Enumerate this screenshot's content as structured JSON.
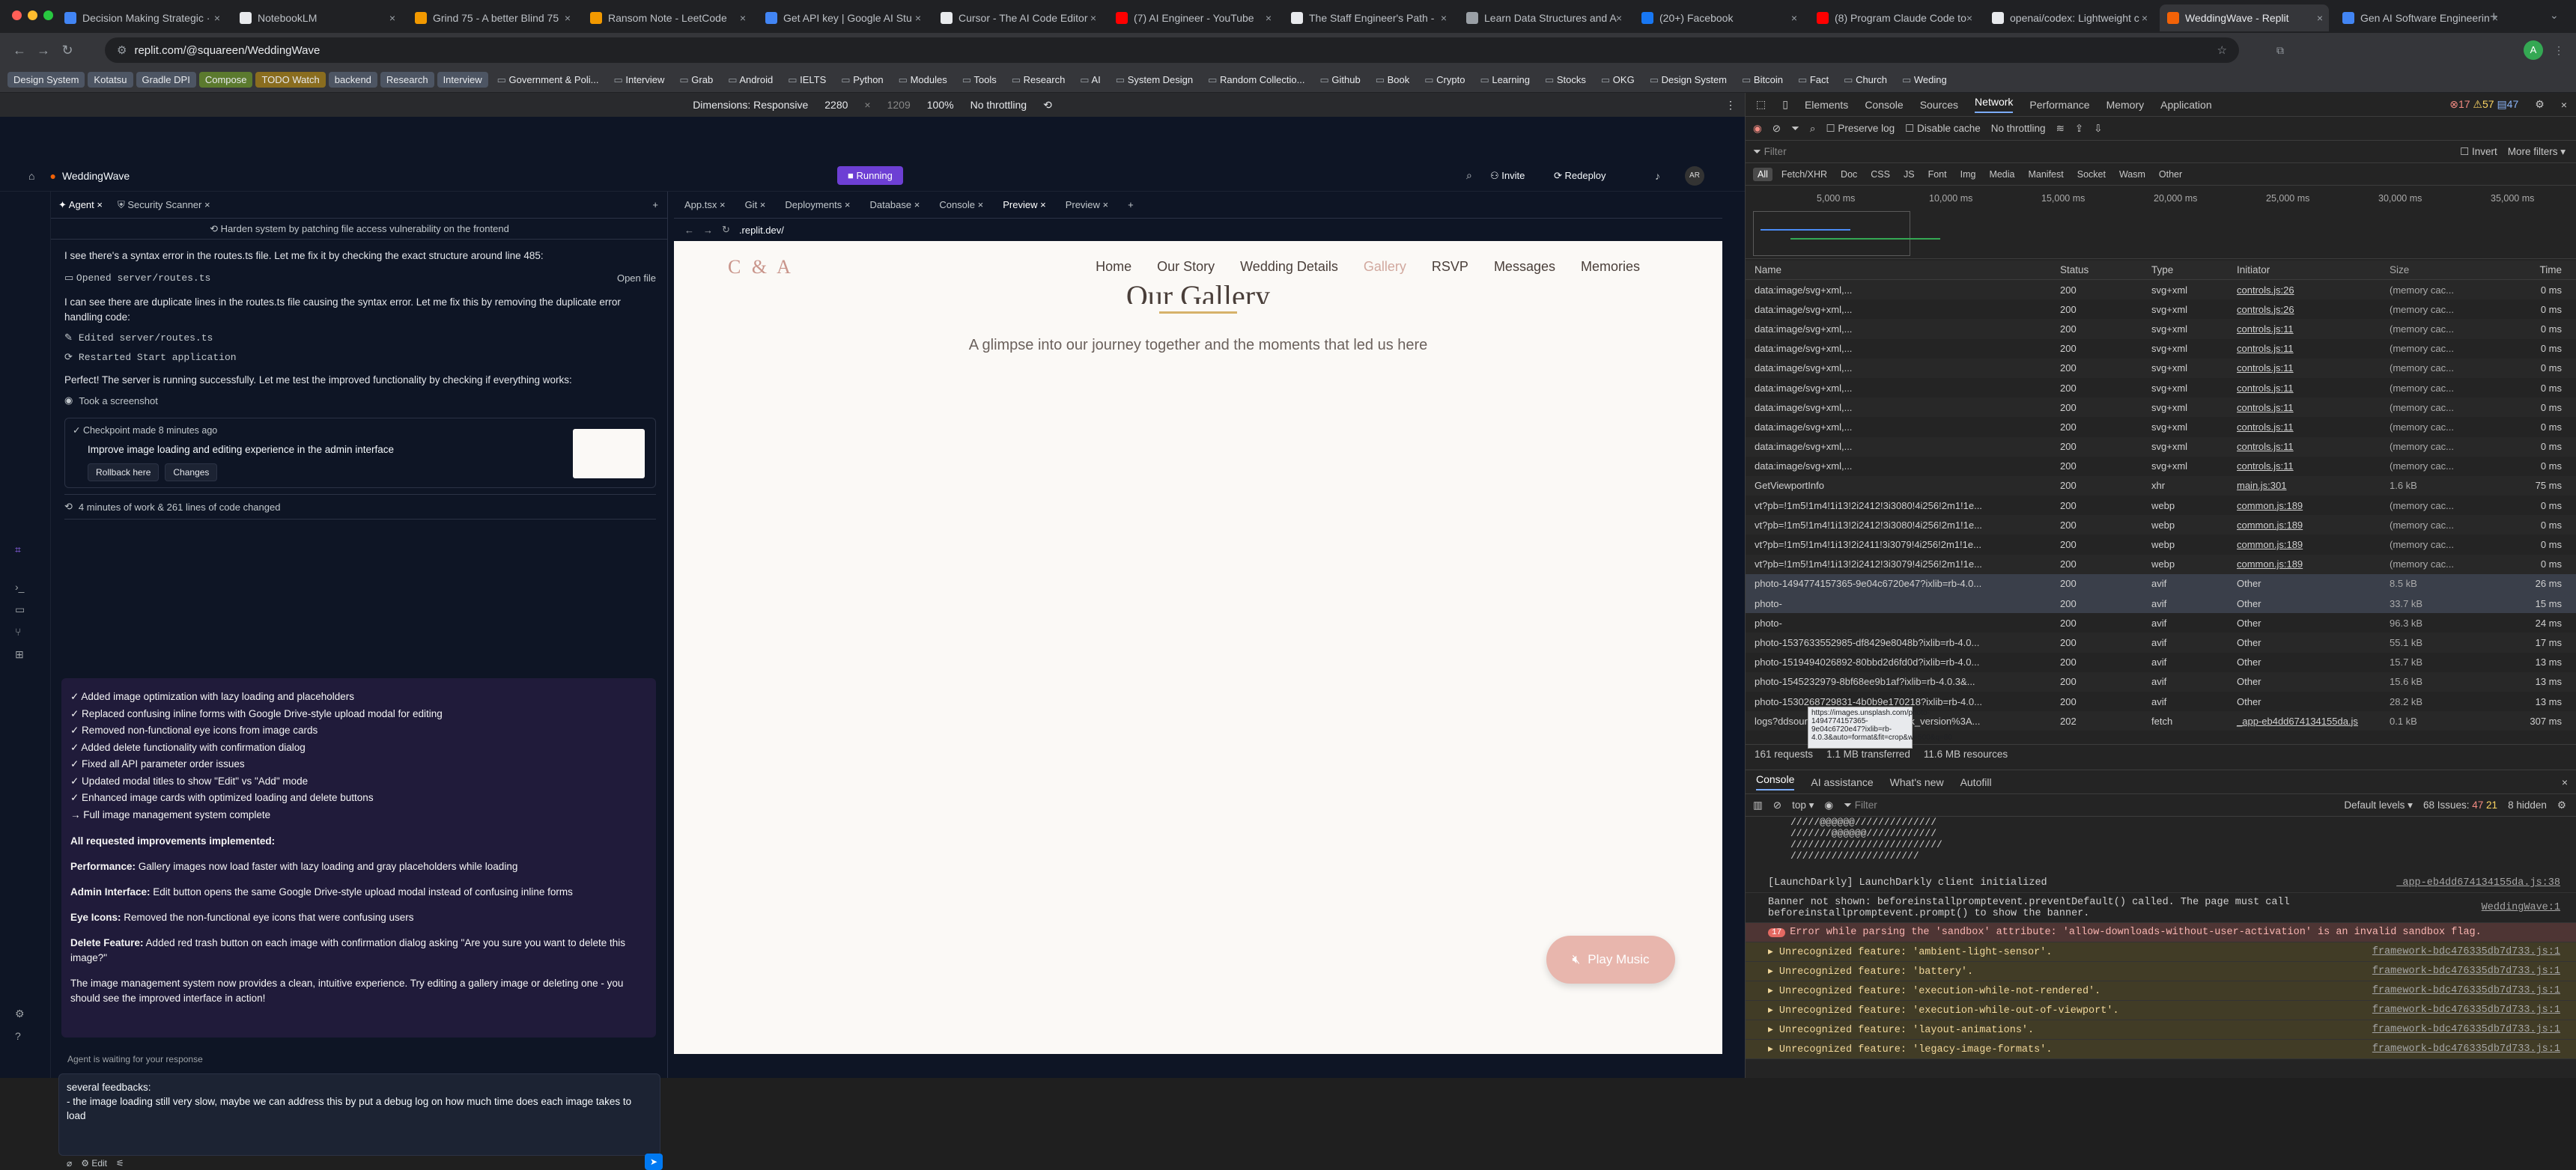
{
  "browser": {
    "tabs": [
      {
        "title": "Decision Making Strategic ·",
        "color": "#4285f4"
      },
      {
        "title": "NotebookLM",
        "color": "#e8eaed"
      },
      {
        "title": "Grind 75 - A better Blind 75",
        "color": "#f29900"
      },
      {
        "title": "Ransom Note - LeetCode",
        "color": "#f29900"
      },
      {
        "title": "Get API key | Google AI Stu",
        "color": "#4285f4"
      },
      {
        "title": "Cursor - The AI Code Editor",
        "color": "#e8eaed"
      },
      {
        "title": "(7) AI Engineer - YouTube",
        "color": "#ff0000"
      },
      {
        "title": "The Staff Engineer's Path -",
        "color": "#e8eaed"
      },
      {
        "title": "Learn Data Structures and A",
        "color": "#9aa0a6"
      },
      {
        "title": "(20+) Facebook",
        "color": "#1877f2"
      },
      {
        "title": "(8) Program Claude Code to",
        "color": "#ff0000"
      },
      {
        "title": "openai/codex: Lightweight c",
        "color": "#e8eaed"
      },
      {
        "title": "WeddingWave - Replit",
        "color": "#f26207"
      },
      {
        "title": "Gen AI Software Engineerin",
        "color": "#4285f4"
      }
    ],
    "url": "replit.com/@squareen/WeddingWave",
    "bookmarks": [
      {
        "label": "Design System",
        "tag": true
      },
      {
        "label": "Kotatsu",
        "tag": true
      },
      {
        "label": "Gradle DPI",
        "tag": true
      },
      {
        "label": "Compose",
        "tag": true
      },
      {
        "label": "TODO Watch",
        "tag": true
      },
      {
        "label": "backend",
        "tag": true
      },
      {
        "label": "Research",
        "tag": true
      },
      {
        "label": "Interview",
        "tag": true
      },
      {
        "label": "Government & Poli...",
        "tag": false
      },
      {
        "label": "Interview",
        "tag": false
      },
      {
        "label": "Grab",
        "tag": false
      },
      {
        "label": "Android",
        "tag": false
      },
      {
        "label": "IELTS",
        "tag": false
      },
      {
        "label": "Python",
        "tag": false
      },
      {
        "label": "Modules",
        "tag": false
      },
      {
        "label": "Tools",
        "tag": false
      },
      {
        "label": "Research",
        "tag": false
      },
      {
        "label": "AI",
        "tag": false
      },
      {
        "label": "System Design",
        "tag": false
      },
      {
        "label": "Random Collectio...",
        "tag": false
      },
      {
        "label": "Github",
        "tag": false
      },
      {
        "label": "Book",
        "tag": false
      },
      {
        "label": "Crypto",
        "tag": false
      },
      {
        "label": "Learning",
        "tag": false
      },
      {
        "label": "Stocks",
        "tag": false
      },
      {
        "label": "OKG",
        "tag": false
      },
      {
        "label": "Design System",
        "tag": false
      },
      {
        "label": "Bitcoin",
        "tag": false
      },
      {
        "label": "Fact",
        "tag": false
      },
      {
        "label": "Church",
        "tag": false
      },
      {
        "label": "Weding",
        "tag": false
      }
    ]
  },
  "device": {
    "dimensions": "Dimensions: Responsive",
    "width": "2280",
    "height": "1209",
    "zoom": "100%",
    "throttle": "No throttling"
  },
  "replit": {
    "project": "WeddingWave",
    "status": "Running",
    "invite": "Invite",
    "redeploy": "Redeploy",
    "agent_tab": "Agent",
    "security_tab": "Security Scanner",
    "task": "Harden system by patching file access vulnerability on the frontend",
    "m1": "I see there's a syntax error in the routes.ts file. Let me fix it by checking the exact structure around line 485:",
    "opened": "Opened server/routes.ts",
    "open_file": "Open file",
    "m2": "I can see there are duplicate lines in the routes.ts file causing the syntax error. Let me fix this by removing the duplicate error handling code:",
    "edited": "Edited server/routes.ts",
    "restarted": "Restarted Start application",
    "m3": "Perfect! The server is running successfully. Let me test the improved functionality by checking if everything works:",
    "screenshot": "Took a screenshot",
    "checkpoint": "Checkpoint made 8 minutes ago",
    "checkpoint_desc": "Improve image loading and editing experience in the admin interface",
    "rollback": "Rollback here",
    "changes": "Changes",
    "work": "4 minutes of work & 261 lines of code changed",
    "items": [
      "✓ Added image optimization with lazy loading and placeholders",
      "✓ Replaced confusing inline forms with Google Drive-style upload modal for editing",
      "✓ Removed non-functional eye icons from image cards",
      "✓ Added delete functionality with confirmation dialog",
      "✓ Fixed all API parameter order issues",
      "✓ Updated modal titles to show \"Edit\" vs \"Add\" mode",
      "✓ Enhanced image cards with optimized loading and delete buttons",
      "→ Full image management system complete"
    ],
    "impl_title": "All requested improvements implemented:",
    "p1_b": "Performance:",
    "p1": " Gallery images now load faster with lazy loading and gray placeholders while loading",
    "p2_b": "Admin Interface:",
    "p2": " Edit button opens the same Google Drive-style upload modal instead of confusing inline forms",
    "p3_b": "Eye Icons:",
    "p3": " Removed the non-functional eye icons that were confusing users",
    "p4_b": "Delete Feature:",
    "p4": " Added red trash button on each image with confirmation dialog asking \"Are you sure you want to delete this image?\"",
    "p5": "The image management system now provides a clean, intuitive experience. Try editing a gallery image or deleting one - you should see the improved interface in action!",
    "waiting": "Agent is waiting for your response",
    "input1": "several feedbacks:",
    "input2": "- the image loading still very slow, maybe we can address this by put a debug log on how much time does each image takes to load",
    "edit": "Edit",
    "ptabs": [
      "App.tsx",
      "Git",
      "Deployments",
      "Database",
      "Console",
      "Preview",
      "Preview"
    ],
    "preview_url": ".replit.dev/"
  },
  "site": {
    "logo": "C & A",
    "nav": [
      "Home",
      "Our Story",
      "Wedding Details",
      "Gallery",
      "RSVP",
      "Messages",
      "Memories"
    ],
    "title": "Our Gallery",
    "subtitle": "A glimpse into our journey together and the moments that led us here",
    "music": "Play Music"
  },
  "devtools": {
    "tabs": [
      "Elements",
      "Console",
      "Sources",
      "Network",
      "Performance",
      "Memory",
      "Application"
    ],
    "issues": {
      "errors": "17",
      "warnings": "57",
      "info": "47"
    },
    "preserve": "Preserve log",
    "disable_cache": "Disable cache",
    "throttle": "No throttling",
    "filter": "Filter",
    "invert": "Invert",
    "more_filters": "More filters",
    "types": [
      "All",
      "Fetch/XHR",
      "Doc",
      "CSS",
      "JS",
      "Font",
      "Img",
      "Media",
      "Manifest",
      "Socket",
      "Wasm",
      "Other"
    ],
    "timeline": [
      "5,000 ms",
      "10,000 ms",
      "15,000 ms",
      "20,000 ms",
      "25,000 ms",
      "30,000 ms",
      "35,000 ms"
    ],
    "headers": [
      "Name",
      "Status",
      "Type",
      "Initiator",
      "Size",
      "Time"
    ],
    "rows": [
      [
        "data:image/svg+xml,...",
        "200",
        "svg+xml",
        "controls.js:26",
        "(memory cac...",
        "0 ms"
      ],
      [
        "data:image/svg+xml,...",
        "200",
        "svg+xml",
        "controls.js:26",
        "(memory cac...",
        "0 ms"
      ],
      [
        "data:image/svg+xml,...",
        "200",
        "svg+xml",
        "controls.js:11",
        "(memory cac...",
        "0 ms"
      ],
      [
        "data:image/svg+xml,...",
        "200",
        "svg+xml",
        "controls.js:11",
        "(memory cac...",
        "0 ms"
      ],
      [
        "data:image/svg+xml,...",
        "200",
        "svg+xml",
        "controls.js:11",
        "(memory cac...",
        "0 ms"
      ],
      [
        "data:image/svg+xml,...",
        "200",
        "svg+xml",
        "controls.js:11",
        "(memory cac...",
        "0 ms"
      ],
      [
        "data:image/svg+xml,...",
        "200",
        "svg+xml",
        "controls.js:11",
        "(memory cac...",
        "0 ms"
      ],
      [
        "data:image/svg+xml,...",
        "200",
        "svg+xml",
        "controls.js:11",
        "(memory cac...",
        "0 ms"
      ],
      [
        "data:image/svg+xml,...",
        "200",
        "svg+xml",
        "controls.js:11",
        "(memory cac...",
        "0 ms"
      ],
      [
        "data:image/svg+xml,...",
        "200",
        "svg+xml",
        "controls.js:11",
        "(memory cac...",
        "0 ms"
      ],
      [
        "GetViewportInfo",
        "200",
        "xhr",
        "main.js:301",
        "1.6 kB",
        "75 ms"
      ],
      [
        "vt?pb=!1m5!1m4!1i13!2i2412!3i3080!4i256!2m1!1e...",
        "200",
        "webp",
        "common.js:189",
        "(memory cac...",
        "0 ms"
      ],
      [
        "vt?pb=!1m5!1m4!1i13!2i2412!3i3080!4i256!2m1!1e...",
        "200",
        "webp",
        "common.js:189",
        "(memory cac...",
        "0 ms"
      ],
      [
        "vt?pb=!1m5!1m4!1i13!2i2411!3i3079!4i256!2m1!1e...",
        "200",
        "webp",
        "common.js:189",
        "(memory cac...",
        "0 ms"
      ],
      [
        "vt?pb=!1m5!1m4!1i13!2i2412!3i3079!4i256!2m1!1e...",
        "200",
        "webp",
        "common.js:189",
        "(memory cac...",
        "0 ms"
      ],
      [
        "photo-1494774157365-9e04c6720e47?ixlib=rb-4.0...",
        "200",
        "avif",
        "Other",
        "8.5 kB",
        "26 ms"
      ],
      [
        "photo-",
        "200",
        "avif",
        "Other",
        "33.7 kB",
        "15 ms"
      ],
      [
        "photo-",
        "200",
        "avif",
        "Other",
        "96.3 kB",
        "24 ms"
      ],
      [
        "photo-1537633552985-df8429e8048b?ixlib=rb-4.0...",
        "200",
        "avif",
        "Other",
        "55.1 kB",
        "17 ms"
      ],
      [
        "photo-1519494026892-80bbd2d6fd0d?ixlib=rb-4.0...",
        "200",
        "avif",
        "Other",
        "15.7 kB",
        "13 ms"
      ],
      [
        "photo-1545232979-8bf68ee9b1af?ixlib=rb-4.0.3&...",
        "200",
        "avif",
        "Other",
        "15.6 kB",
        "13 ms"
      ],
      [
        "photo-1530268729831-4b0b9e170218?ixlib=rb-4.0...",
        "200",
        "avif",
        "Other",
        "28.2 kB",
        "13 ms"
      ],
      [
        "logs?ddsource=browser&ddtags=sdk_version%3A...",
        "202",
        "fetch",
        "_app-eb4dd674134155da.js",
        "0.1 kB",
        "307 ms"
      ]
    ],
    "tooltip": "https://images.unsplash.com/photo-1494774157365-9e04c6720e47?ixlib=rb-4.0.3&auto=format&fit=crop&w=500&q=80",
    "summary": [
      "161 requests",
      "1.1 MB transferred",
      "11.6 MB resources"
    ],
    "drawer_tabs": [
      "Console",
      "AI assistance",
      "What's new",
      "Autofill"
    ],
    "context": "top",
    "levels": "Default levels",
    "issues_label": "68 Issues:",
    "issue_err": "47",
    "issue_warn": "21",
    "hidden": "8 hidden",
    "ascii": [
      "/////@@@@@@//////////////",
      "///////@@@@@@////////////",
      "//////////////////////////",
      "//////////////////////"
    ],
    "logs": [
      {
        "t": "[LaunchDarkly] LaunchDarkly client initialized",
        "s": "_app-eb4dd674134155da.js:38",
        "k": ""
      },
      {
        "t": "Banner not shown: beforeinstallpromptevent.preventDefault() called. The page must call beforeinstallpromptevent.prompt() to show the banner.",
        "s": "WeddingWave:1",
        "k": ""
      },
      {
        "t": "Error while parsing the 'sandbox' attribute: 'allow-downloads-without-user-activation' is an invalid sandbox flag.",
        "s": "",
        "k": "err",
        "n": "17"
      },
      {
        "t": "Unrecognized feature: 'ambient-light-sensor'.",
        "s": "framework-bdc476335db7d733.js:1",
        "k": "warn"
      },
      {
        "t": "Unrecognized feature: 'battery'.",
        "s": "framework-bdc476335db7d733.js:1",
        "k": "warn"
      },
      {
        "t": "Unrecognized feature: 'execution-while-not-rendered'.",
        "s": "framework-bdc476335db7d733.js:1",
        "k": "warn"
      },
      {
        "t": "Unrecognized feature: 'execution-while-out-of-viewport'.",
        "s": "framework-bdc476335db7d733.js:1",
        "k": "warn"
      },
      {
        "t": "Unrecognized feature: 'layout-animations'.",
        "s": "framework-bdc476335db7d733.js:1",
        "k": "warn"
      },
      {
        "t": "Unrecognized feature: 'legacy-image-formats'.",
        "s": "framework-bdc476335db7d733.js:1",
        "k": "warn"
      }
    ]
  }
}
